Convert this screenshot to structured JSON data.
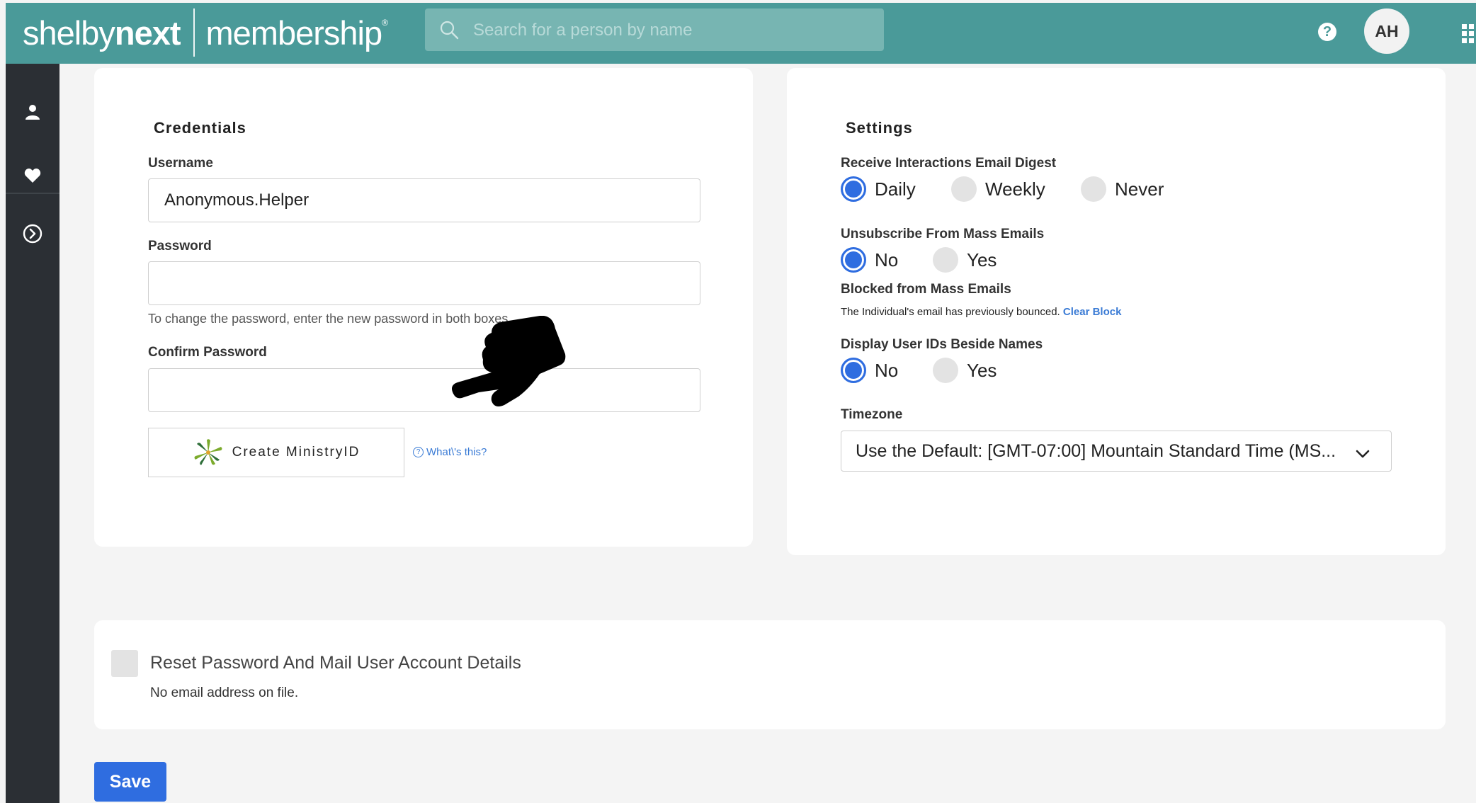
{
  "header": {
    "brand_part1": "shelby",
    "brand_part2": "next",
    "brand_product": "membership",
    "brand_reg": "®",
    "search_placeholder": "Search for a person by name",
    "help_label": "?",
    "avatar_initials": "AH"
  },
  "icons": {
    "search": "search-icon",
    "help": "help-icon",
    "apps": "apps-grid-icon",
    "sidebar": [
      "person-icon",
      "heart-icon",
      "chevron-right-circle-icon"
    ],
    "ministry_logo": "ministryid-logo-icon",
    "pointer": "pointing-hand-icon"
  },
  "credentials": {
    "title": "Credentials",
    "username_label": "Username",
    "username_value": "Anonymous.Helper",
    "password_label": "Password",
    "password_hint": "To change the password, enter the new password in both boxes.",
    "confirm_label": "Confirm Password",
    "create_ministry_label": "Create MinistryID",
    "whats_this_q": "?",
    "whats_this_label": "What\\'s this?"
  },
  "settings": {
    "title": "Settings",
    "digest_label": "Receive Interactions Email Digest",
    "digest_options": [
      "Daily",
      "Weekly",
      "Never"
    ],
    "digest_selected": "Daily",
    "unsubscribe_label": "Unsubscribe From Mass Emails",
    "unsubscribe_options": [
      "No",
      "Yes"
    ],
    "unsubscribe_selected": "No",
    "blocked_label": "Blocked from Mass Emails",
    "blocked_text": "The Individual's email has previously bounced.",
    "clear_block_label": "Clear Block",
    "display_ids_label": "Display User IDs Beside Names",
    "display_ids_options": [
      "No",
      "Yes"
    ],
    "display_ids_selected": "No",
    "timezone_label": "Timezone",
    "timezone_value": "Use the Default: [GMT-07:00] Mountain Standard Time (MS..."
  },
  "reset": {
    "title": "Reset Password And Mail User Account Details",
    "note": "No email address on file.",
    "checked": false
  },
  "actions": {
    "save_label": "Save"
  },
  "colors": {
    "header_bg": "#4a9a99",
    "sidebar_bg": "#2b2f34",
    "accent": "#2f6de0",
    "link": "#3a7bd5"
  }
}
